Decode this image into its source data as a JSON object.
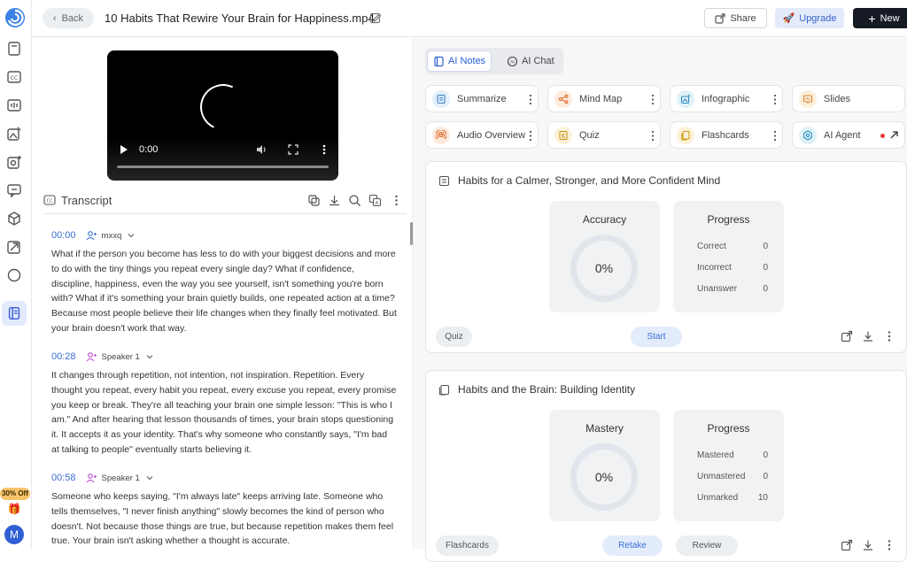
{
  "header": {
    "back_label": "Back",
    "title": "10 Habits That Rewire Your Brain for Happiness.mp4",
    "share_label": "Share",
    "upgrade_label": "Upgrade",
    "new_label": "New"
  },
  "sidebar": {
    "promo_badge": "30% Off",
    "avatar_initial": "M",
    "icons": [
      "notebook-icon",
      "cc-icon",
      "dashboard-icon",
      "image-edit-icon",
      "camera-plus-icon",
      "message-icon",
      "cube-icon",
      "feather-icon",
      "circle-icon",
      "notes-icon"
    ]
  },
  "video": {
    "time": "0:00"
  },
  "transcript": {
    "label": "Transcript",
    "segments": [
      {
        "time": "00:00",
        "speaker": "mxxq",
        "text": "What if the person you become has less to do with your biggest decisions and more to do with the tiny things you repeat every single day? What if confidence, discipline, happiness, even the way you see yourself, isn't something you're born with? What if it's something your brain quietly builds, one repeated action at a time? Because most people believe their life changes when they finally feel motivated. But your brain doesn't work that way."
      },
      {
        "time": "00:28",
        "speaker": "Speaker 1",
        "text": "It changes through repetition, not intention, not inspiration. Repetition. Every thought you repeat, every habit you repeat, every excuse you repeat, every promise you keep or break. They're all teaching your brain one simple lesson: \"This is who I am.\" And after hearing that lesson thousands of times, your brain stops questioning it. It accepts it as your identity. That's why someone who constantly says, \"I'm bad at talking to people\" eventually starts believing it."
      },
      {
        "time": "00:58",
        "speaker": "Speaker 1",
        "text": "Someone who keeps saying, \"I'm always late\" keeps arriving late. Someone who tells themselves, \"I never finish anything\" slowly becomes the kind of person who doesn't. Not because those things are true, but because repetition makes them feel true. Your brain isn't asking whether a thought is accurate."
      }
    ]
  },
  "panel": {
    "tabs": [
      {
        "label": "AI Notes",
        "active": true
      },
      {
        "label": "AI Chat",
        "active": false
      }
    ],
    "tools": [
      {
        "label": "Summarize",
        "icon": "summarize-icon",
        "color": "#3b82c4",
        "bg": "#e3effa"
      },
      {
        "label": "Mind Map",
        "icon": "mind-map-icon",
        "color": "#e0702a",
        "bg": "#fcebdf"
      },
      {
        "label": "Infographic",
        "icon": "infographic-icon",
        "color": "#2a8fbf",
        "bg": "#e0f1f8"
      },
      {
        "label": "Slides",
        "icon": "slides-icon",
        "color": "#d9822b",
        "bg": "#fcefdc"
      },
      {
        "label": "Audio Overview",
        "icon": "audio-icon",
        "color": "#e06a2a",
        "bg": "#fde9dc"
      },
      {
        "label": "Quiz",
        "icon": "quiz-icon",
        "color": "#c99215",
        "bg": "#fbf2d8"
      },
      {
        "label": "Flashcards",
        "icon": "flashcards-icon",
        "color": "#d39a18",
        "bg": "#fbf1d6"
      },
      {
        "label": "AI Agent",
        "icon": "ai-agent-icon",
        "color": "#2a8fbf",
        "bg": "#e0f1f8"
      }
    ],
    "quiz_card": {
      "title": "Habits for a Calmer, Stronger, and More Confident Mind",
      "stat_title": "Accuracy",
      "stat_value": "0%",
      "progress_title": "Progress",
      "rows": [
        {
          "label": "Correct",
          "value": "0"
        },
        {
          "label": "Incorrect",
          "value": "0"
        },
        {
          "label": "Unanswer",
          "value": "0"
        }
      ],
      "tag": "Quiz",
      "action": "Start"
    },
    "flash_card": {
      "title": "Habits and the Brain: Building Identity",
      "stat_title": "Mastery",
      "stat_value": "0%",
      "progress_title": "Progress",
      "rows": [
        {
          "label": "Mastered",
          "value": "0"
        },
        {
          "label": "Unmastered",
          "value": "0"
        },
        {
          "label": "Unmarked",
          "value": "10"
        }
      ],
      "tag": "Flashcards",
      "action": "Retake",
      "action2": "Review"
    }
  }
}
